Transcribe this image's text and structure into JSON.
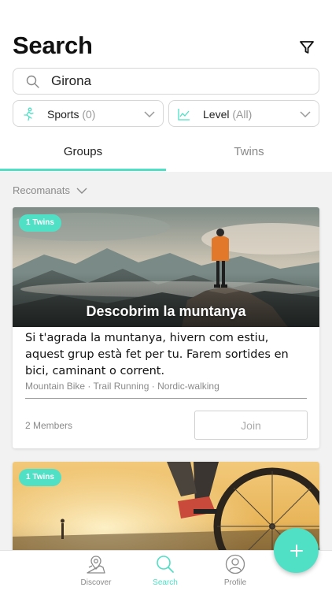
{
  "header": {
    "title": "Search"
  },
  "search": {
    "value": "Girona"
  },
  "filters": {
    "sports": {
      "label": "Sports",
      "count": "(0)"
    },
    "level": {
      "label": "Level",
      "count": "(All)"
    }
  },
  "tabs": [
    {
      "label": "Groups",
      "active": true
    },
    {
      "label": "Twins",
      "active": false
    }
  ],
  "section": {
    "label": "Recomanats"
  },
  "cards": [
    {
      "badge": "1 Twins",
      "title": "Descobrim la muntanya",
      "description": "Si t'agrada la muntanya, hivern com estiu, aquest grup està fet per tu. Farem sortides en bici, caminant o corrent.",
      "tags": "Mountain Bike · Trail Running · Nordic-walking",
      "members": "2 Members",
      "join_label": "Join"
    },
    {
      "badge": "1 Twins"
    }
  ],
  "fab": {
    "icon": "plus-icon"
  },
  "bottom_nav": [
    {
      "label": "Discover",
      "icon": "map-pin-icon"
    },
    {
      "label": "Search",
      "icon": "search-icon",
      "active": true
    },
    {
      "label": "Profile",
      "icon": "user-icon"
    }
  ],
  "colors": {
    "accent": "#4fe0c5",
    "text": "#1a1a1a",
    "muted": "#8a8a8a",
    "background": "#f2f2f2"
  }
}
